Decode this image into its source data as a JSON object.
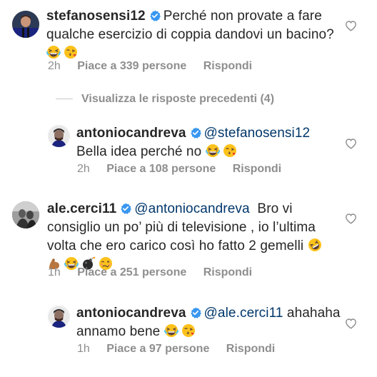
{
  "comments": [
    {
      "username": "stefanosensi12",
      "text_line1": "Perché non provate a fare",
      "text_line2": "qualche esercizio di coppia dandovi un bacino?",
      "time": "2h",
      "likes": "Piace a 339 persone",
      "reply": "Rispondi"
    },
    {
      "username": "antoniocandreva",
      "mention": "@stefanosensi12",
      "text_line2": "Bella idea perché no",
      "time": "2h",
      "likes": "Piace a 108 persone",
      "reply": "Rispondi"
    },
    {
      "username": "ale.cerci11",
      "mention": "@antoniocandreva",
      "text_line1": "Bro vi",
      "text_line2": "consiglio un po’ più di televisione , io l’ultima",
      "text_line3": "volta che ero carico così ho fatto 2 gemelli",
      "time": "1h",
      "likes": "Piace a 251 persone",
      "reply": "Rispondi"
    },
    {
      "username": "antoniocandreva",
      "mention": "@ale.cerci11",
      "text_line1": "ahahaha",
      "text_line2": "annamo bene",
      "time": "1h",
      "likes": "Piace a 97 persone",
      "reply": "Rispondi"
    }
  ],
  "view_replies": "Visualizza le risposte precedenti (4)",
  "colors": {
    "text": "#262626",
    "meta": "#8e8e8e",
    "mention": "#00376b",
    "verified": "#3897f0"
  },
  "icons": [
    "verified-badge-icon",
    "heart-outline-icon",
    "laughing-tears-emoji",
    "kiss-emoji",
    "rofl-emoji",
    "flexed-biceps-emoji",
    "bomb-emoji",
    "woozy-face-emoji"
  ]
}
